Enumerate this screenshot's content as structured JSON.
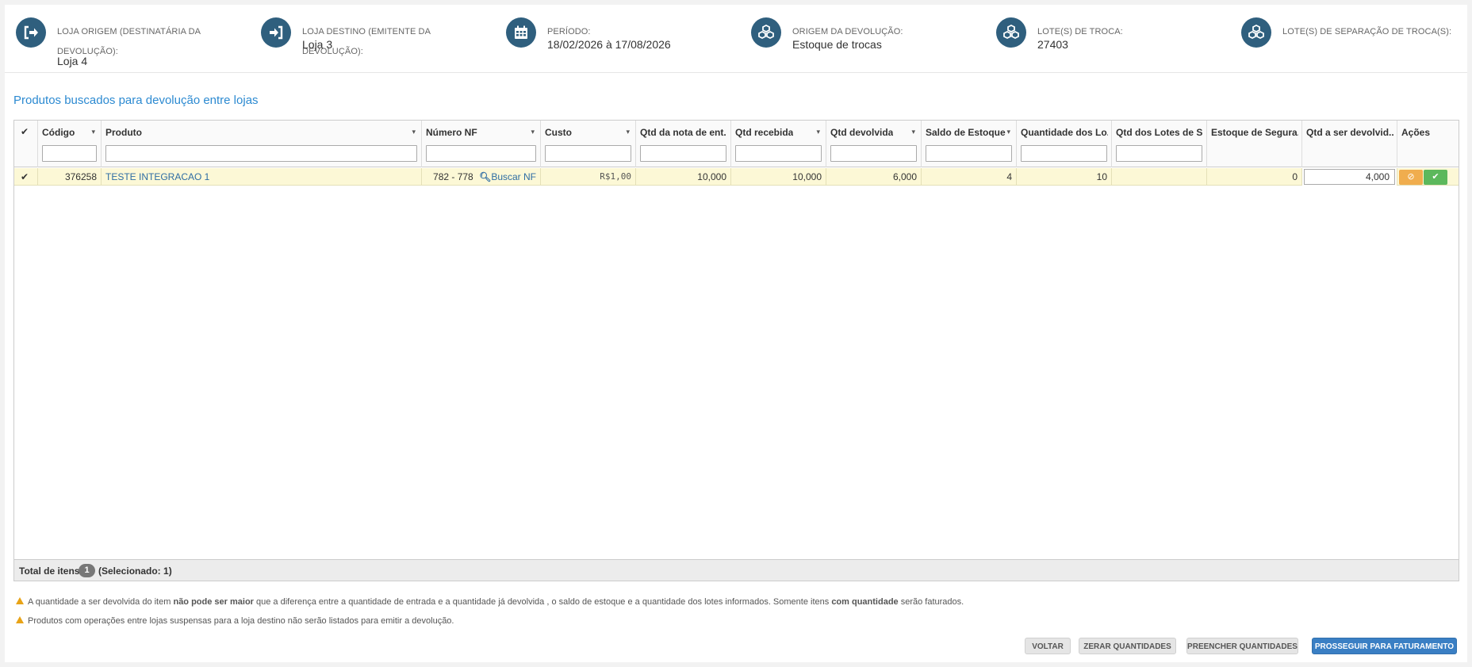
{
  "header": {
    "origem": {
      "label_line1": "LOJA ORIGEM (DESTINATÁRIA DA",
      "label_line2": "DEVOLUÇÃO):",
      "value": "Loja 4",
      "icon": "sign-out-icon"
    },
    "destino": {
      "label": "LOJA DESTINO (EMITENTE DA DEVOLUÇÃO):",
      "value": "Loja 3",
      "icon": "sign-in-icon"
    },
    "periodo": {
      "label": "PERÍODO:",
      "value": "18/02/2026 à 17/08/2026",
      "icon": "calendar-icon"
    },
    "origem_devolucao": {
      "label": "ORIGEM DA DEVOLUÇÃO:",
      "value": "Estoque de trocas",
      "icon": "cubes-icon"
    },
    "lotes_troca": {
      "label": "LOTE(S) DE TROCA:",
      "value": "27403",
      "icon": "cubes-icon"
    },
    "lotes_separacao": {
      "label": "LOTE(S) DE SEPARAÇÃO DE TROCA(S):",
      "value": "",
      "icon": "cubes-icon"
    }
  },
  "section_title": "Produtos buscados para devolução entre lojas",
  "grid": {
    "columns": {
      "codigo": "Código",
      "produto": "Produto",
      "numero_nf": "Número NF",
      "custo": "Custo",
      "qtd_nota_entrada": "Qtd da nota de ent...",
      "qtd_recebida": "Qtd recebida",
      "qtd_devolvida": "Qtd devolvida",
      "saldo_estoque": "Saldo de Estoque",
      "quantidade_lotes": "Quantidade dos Lo...",
      "qtd_lotes_separacao": "Qtd dos Lotes de S...",
      "estoque_seguranca": "Estoque de Segura...",
      "qtd_a_ser_devolvida": "Qtd a ser devolvid...",
      "acoes": "Ações"
    },
    "rows": [
      {
        "codigo": "376258",
        "produto": "TESTE INTEGRACAO 1",
        "numero_nf": "782 - 778",
        "buscar_nf": "Buscar NF",
        "custo": "R$1,00",
        "qtd_nota_entrada": "10,000",
        "qtd_recebida": "10,000",
        "qtd_devolvida": "6,000",
        "saldo_estoque": "4",
        "quantidade_lotes": "10",
        "qtd_lotes_separacao": "",
        "estoque_seguranca": "0",
        "qtd_a_ser_devolvida": "4,000"
      }
    ],
    "footer": {
      "total_label": "Total de itens:",
      "total_count": "1",
      "selected": "(Selecionado: 1)"
    }
  },
  "notes": {
    "note1_a": "A quantidade a ser devolvida do item ",
    "note1_b": "não pode ser maior",
    "note1_c": " que a diferença entre a quantidade de entrada e a quantidade já devolvida , o saldo de estoque e a quantidade dos lotes informados. Somente itens ",
    "note1_d": "com quantidade",
    "note1_e": " serão faturados.",
    "note2": "Produtos com operações entre lojas suspensas para a loja destino não serão listados para emitir a devolução."
  },
  "buttons": {
    "voltar": "VOLTAR",
    "zerar": "ZERAR QUANTIDADES",
    "preencher": "PREENCHER QUANTIDADES",
    "prosseguir": "PROSSEGUIR PARA FATURAMENTO"
  },
  "colors": {
    "icon_bg": "#2f5f7e",
    "title": "#2c8ad1",
    "row_bg": "#fcf8d6",
    "primary": "#3a7fc4",
    "cancel": "#f0ad4e",
    "confirm": "#5cb85c",
    "warning": "#e8a317"
  }
}
